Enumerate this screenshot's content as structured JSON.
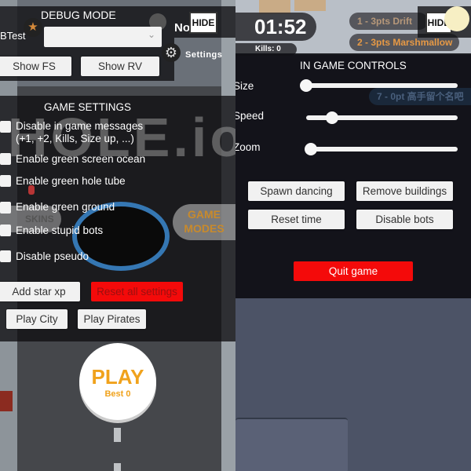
{
  "left": {
    "debug": {
      "title": "DEBUG MODE",
      "ab_label": "BTest",
      "dropdown_value": "",
      "show_fs": "Show FS",
      "show_rv": "Show RV",
      "hide": "HIDE",
      "no_label": "No",
      "settings_label": "Settings"
    },
    "game_settings": {
      "title": "GAME SETTINGS",
      "options": [
        {
          "label": "Disable in game messages",
          "sublabel": "(+1, +2, Kills, Size up, ...)",
          "checked": false
        },
        {
          "label": "Enable green screen ocean",
          "checked": false
        },
        {
          "label": "Enable green hole tube",
          "checked": false
        },
        {
          "label": "Enable green ground",
          "checked": false
        },
        {
          "label": "Enable stupid bots",
          "checked": false
        },
        {
          "label": "Disable pseudo",
          "checked": false
        }
      ],
      "add_star_xp": "Add star xp",
      "reset_all": "Reset all settings",
      "play_city": "Play City",
      "play_pirates": "Play Pirates"
    },
    "scene": {
      "logo": "HOLE.io",
      "skins": "SKINS",
      "game_modes_1": "GAME",
      "game_modes_2": "MODES"
    },
    "play": {
      "label": "PLAY",
      "best": "Best 0"
    }
  },
  "right": {
    "hud": {
      "timer": "01:52",
      "kills": "Kills: 0",
      "hide": "HIDE",
      "ranks": [
        {
          "text": "1 - 3pts Drift"
        },
        {
          "text": "2 - 3pts Marshmallow"
        },
        {
          "text": "7 - 0pt 高手留个名吧"
        }
      ]
    },
    "controls": {
      "title": "IN GAME CONTROLS",
      "sliders": [
        {
          "label": "Size",
          "value": 0.0
        },
        {
          "label": "Speed",
          "value": 0.17
        },
        {
          "label": "Zoom",
          "value": 0.03
        }
      ],
      "spawn_dancing": "Spawn dancing",
      "remove_buildings": "Remove buildings",
      "reset_time": "Reset time",
      "disable_bots": "Disable bots",
      "quit_game": "Quit game"
    }
  },
  "colors": {
    "danger": "#f40a0a",
    "accent_orange": "#f0a21c",
    "hole_ring": "#3577b3"
  }
}
